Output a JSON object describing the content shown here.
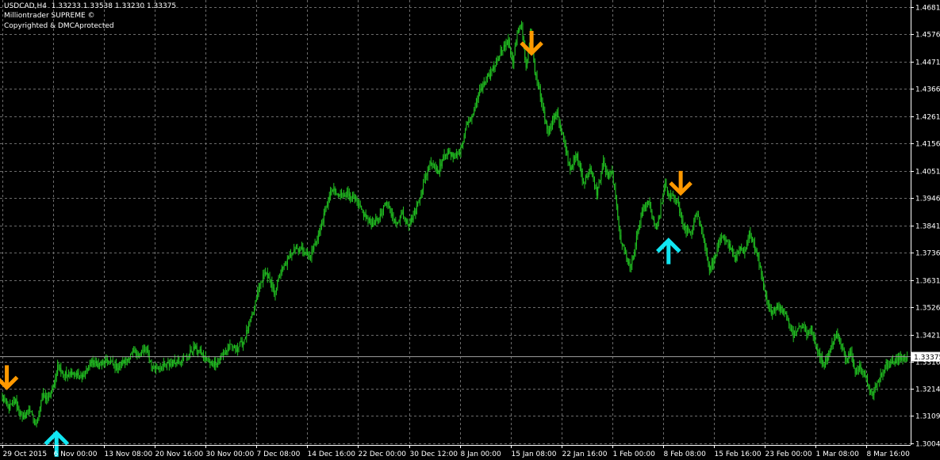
{
  "header": {
    "symbol_timeframe": "USDCAD,H4",
    "ohlc": "1.33233 1.33538 1.33230 1.33375",
    "indicator": "Milliontrader SUPREME ©",
    "copyright": "Copyrighted & DMCAprotected"
  },
  "colors": {
    "background": "#000000",
    "grid": "#6b6b6b",
    "candle": "#22c322",
    "sell_arrow": "#ff9900",
    "buy_arrow": "#11e6f2",
    "axis_text": "#ffffff",
    "current_price_box": "#ffffff",
    "current_price_text": "#000000"
  },
  "chart_data": {
    "type": "candlestick",
    "symbol": "USDCAD",
    "timeframe": "H4",
    "current_price": "1.33375",
    "y_axis": {
      "range": [
        1.2997,
        1.4707
      ],
      "labels": [
        "1.46810",
        "1.45760",
        "1.44710",
        "1.43660",
        "1.42610",
        "1.41560",
        "1.40510",
        "1.39460",
        "1.38410",
        "1.37360",
        "1.36310",
        "1.35260",
        "1.34210",
        "1.33160",
        "1.32140",
        "1.31090",
        "1.30040"
      ],
      "values": [
        1.4681,
        1.4576,
        1.4471,
        1.4366,
        1.4261,
        1.4156,
        1.4051,
        1.3946,
        1.3841,
        1.3736,
        1.3631,
        1.3526,
        1.3421,
        1.3316,
        1.3214,
        1.3109,
        1.3004
      ]
    },
    "x_axis": {
      "labels": [
        "29 Oct 2015",
        "6 Nov 00:00",
        "13 Nov 08:00",
        "20 Nov 16:00",
        "30 Nov 00:00",
        "7 Dec 08:00",
        "14 Dec 16:00",
        "22 Dec 00:00",
        "30 Dec 12:00",
        "8 Jan 00:00",
        "15 Jan 08:00",
        "22 Jan 16:00",
        "1 Feb 00:00",
        "8 Feb 08:00",
        "15 Feb 16:00",
        "23 Feb 00:00",
        "1 Mar 08:00",
        "8 Mar 16:00"
      ],
      "bar_index": [
        0,
        46,
        92,
        138,
        184,
        230,
        276,
        322,
        368,
        414,
        460,
        506,
        552,
        598,
        644,
        690,
        736,
        782
      ]
    },
    "grid": true,
    "total_bars": 820,
    "price_path": [
      [
        0,
        1.318
      ],
      [
        6,
        1.314
      ],
      [
        12,
        1.3165
      ],
      [
        18,
        1.3095
      ],
      [
        24,
        1.314
      ],
      [
        30,
        1.307
      ],
      [
        36,
        1.3185
      ],
      [
        42,
        1.3175
      ],
      [
        46,
        1.3215
      ],
      [
        50,
        1.33
      ],
      [
        56,
        1.3265
      ],
      [
        64,
        1.328
      ],
      [
        72,
        1.3255
      ],
      [
        80,
        1.3315
      ],
      [
        88,
        1.3305
      ],
      [
        96,
        1.332
      ],
      [
        104,
        1.3295
      ],
      [
        112,
        1.3325
      ],
      [
        118,
        1.335
      ],
      [
        124,
        1.3345
      ],
      [
        130,
        1.3365
      ],
      [
        136,
        1.329
      ],
      [
        142,
        1.3295
      ],
      [
        150,
        1.3305
      ],
      [
        158,
        1.332
      ],
      [
        166,
        1.3335
      ],
      [
        174,
        1.337
      ],
      [
        180,
        1.335
      ],
      [
        186,
        1.3315
      ],
      [
        190,
        1.3305
      ],
      [
        196,
        1.3325
      ],
      [
        200,
        1.3345
      ],
      [
        206,
        1.3375
      ],
      [
        212,
        1.3368
      ],
      [
        218,
        1.3395
      ],
      [
        222,
        1.344
      ],
      [
        228,
        1.352
      ],
      [
        232,
        1.36
      ],
      [
        238,
        1.3665
      ],
      [
        246,
        1.358
      ],
      [
        252,
        1.366
      ],
      [
        258,
        1.3705
      ],
      [
        264,
        1.3755
      ],
      [
        272,
        1.3745
      ],
      [
        278,
        1.3715
      ],
      [
        286,
        1.3805
      ],
      [
        292,
        1.389
      ],
      [
        298,
        1.398
      ],
      [
        304,
        1.3955
      ],
      [
        312,
        1.3965
      ],
      [
        320,
        1.3935
      ],
      [
        326,
        1.389
      ],
      [
        334,
        1.3845
      ],
      [
        342,
        1.3875
      ],
      [
        348,
        1.393
      ],
      [
        356,
        1.3845
      ],
      [
        362,
        1.389
      ],
      [
        368,
        1.3845
      ],
      [
        374,
        1.3895
      ],
      [
        382,
        1.4015
      ],
      [
        388,
        1.409
      ],
      [
        394,
        1.405
      ],
      [
        402,
        1.4125
      ],
      [
        408,
        1.4105
      ],
      [
        414,
        1.412
      ],
      [
        420,
        1.422
      ],
      [
        426,
        1.4275
      ],
      [
        432,
        1.4355
      ],
      [
        438,
        1.4395
      ],
      [
        446,
        1.446
      ],
      [
        452,
        1.452
      ],
      [
        458,
        1.4545
      ],
      [
        462,
        1.447
      ],
      [
        466,
        1.4575
      ],
      [
        470,
        1.461
      ],
      [
        474,
        1.4445
      ],
      [
        478,
        1.4585
      ],
      [
        482,
        1.4425
      ],
      [
        486,
        1.4365
      ],
      [
        490,
        1.428
      ],
      [
        494,
        1.419
      ],
      [
        498,
        1.425
      ],
      [
        502,
        1.428
      ],
      [
        508,
        1.4165
      ],
      [
        514,
        1.4055
      ],
      [
        520,
        1.4115
      ],
      [
        526,
        1.4005
      ],
      [
        532,
        1.4055
      ],
      [
        538,
        1.3965
      ],
      [
        544,
        1.408
      ],
      [
        548,
        1.403
      ],
      [
        552,
        1.4045
      ],
      [
        556,
        1.391
      ],
      [
        560,
        1.378
      ],
      [
        564,
        1.3735
      ],
      [
        568,
        1.3675
      ],
      [
        572,
        1.3745
      ],
      [
        576,
        1.3835
      ],
      [
        580,
        1.3905
      ],
      [
        584,
        1.3935
      ],
      [
        588,
        1.3875
      ],
      [
        592,
        1.3815
      ],
      [
        596,
        1.3915
      ],
      [
        600,
        1.3995
      ],
      [
        604,
        1.3945
      ],
      [
        608,
        1.3955
      ],
      [
        612,
        1.391
      ],
      [
        616,
        1.3835
      ],
      [
        620,
        1.382
      ],
      [
        624,
        1.3815
      ],
      [
        628,
        1.389
      ],
      [
        632,
        1.3845
      ],
      [
        636,
        1.3765
      ],
      [
        640,
        1.3675
      ],
      [
        644,
        1.3705
      ],
      [
        648,
        1.3765
      ],
      [
        652,
        1.3805
      ],
      [
        656,
        1.3775
      ],
      [
        660,
        1.3745
      ],
      [
        664,
        1.3705
      ],
      [
        668,
        1.3765
      ],
      [
        672,
        1.3735
      ],
      [
        676,
        1.3815
      ],
      [
        680,
        1.3765
      ],
      [
        684,
        1.3725
      ],
      [
        688,
        1.362
      ],
      [
        692,
        1.3545
      ],
      [
        696,
        1.3495
      ],
      [
        700,
        1.3535
      ],
      [
        704,
        1.3525
      ],
      [
        708,
        1.3505
      ],
      [
        712,
        1.3465
      ],
      [
        716,
        1.342
      ],
      [
        720,
        1.3445
      ],
      [
        724,
        1.3455
      ],
      [
        728,
        1.3425
      ],
      [
        732,
        1.3445
      ],
      [
        736,
        1.3375
      ],
      [
        740,
        1.334
      ],
      [
        744,
        1.3305
      ],
      [
        748,
        1.3355
      ],
      [
        752,
        1.339
      ],
      [
        756,
        1.3425
      ],
      [
        760,
        1.337
      ],
      [
        764,
        1.3325
      ],
      [
        768,
        1.3355
      ],
      [
        772,
        1.3265
      ],
      [
        776,
        1.3305
      ],
      [
        780,
        1.328
      ],
      [
        784,
        1.323
      ],
      [
        788,
        1.319
      ],
      [
        792,
        1.3235
      ],
      [
        796,
        1.3275
      ],
      [
        800,
        1.3305
      ],
      [
        806,
        1.3315
      ],
      [
        812,
        1.3325
      ],
      [
        818,
        1.33375
      ]
    ],
    "signals": [
      {
        "type": "sell",
        "bar": 4,
        "price": 1.3218
      },
      {
        "type": "buy",
        "bar": 49,
        "price": 1.3043
      },
      {
        "type": "sell",
        "bar": 479,
        "price": 1.4503
      },
      {
        "type": "buy",
        "bar": 603,
        "price": 1.3783
      },
      {
        "type": "sell",
        "bar": 614,
        "price": 1.3965
      }
    ]
  }
}
